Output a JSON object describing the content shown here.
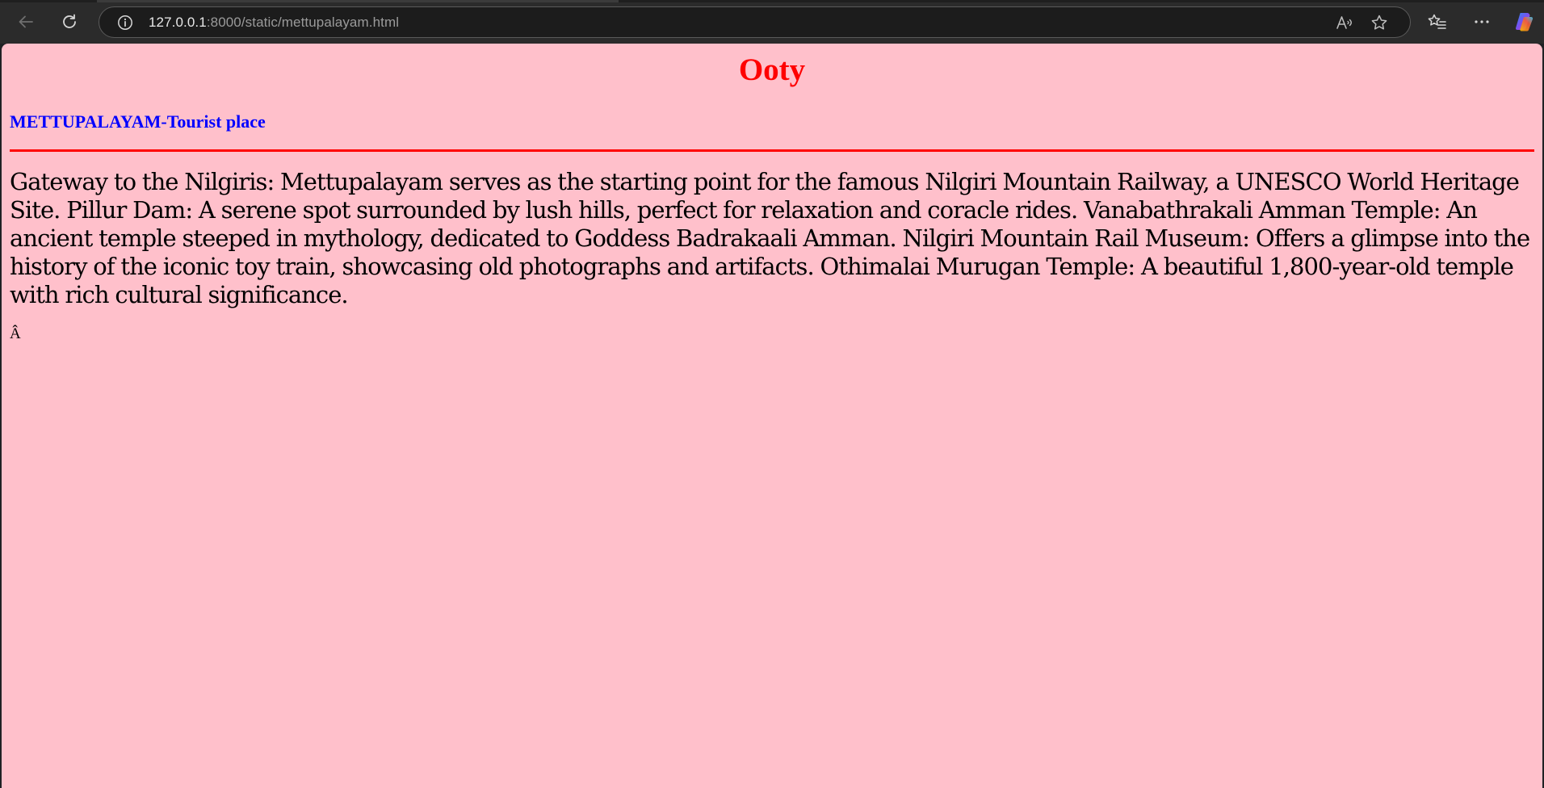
{
  "browser": {
    "url_host": "127.0.0.1",
    "url_rest": ":8000/static/mettupalayam.html",
    "icons": {
      "back": "back-arrow-icon",
      "reload": "reload-icon",
      "info": "info-icon",
      "read_aloud": "read-aloud-icon",
      "favorite": "star-icon",
      "favorites": "favorites-list-icon",
      "more": "more-dots-icon",
      "copilot": "copilot-icon"
    }
  },
  "page": {
    "title": "Ooty",
    "subtitle": "METTUPALAYAM-Tourist place",
    "body": "Gateway to the Nilgiris: Mettupalayam serves as the starting point for the famous Nilgiri Mountain Railway, a UNESCO World Heritage Site. Pillur Dam: A serene spot surrounded by lush hills, perfect for relaxation and coracle rides. Vanabathrakali Amman Temple: An ancient temple steeped in mythology, dedicated to Goddess Badrakaali Amman. Nilgiri Mountain Rail Museum: Offers a glimpse into the history of the iconic toy train, showcasing old photographs and artifacts. Othimalai Murugan Temple: A beautiful 1,800-year-old temple with rich cultural significance.",
    "stray_char": "Â",
    "colors": {
      "background": "#ffc0cb",
      "title": "#ff0000",
      "subtitle": "#0000ff",
      "divider": "#ff0000"
    }
  }
}
